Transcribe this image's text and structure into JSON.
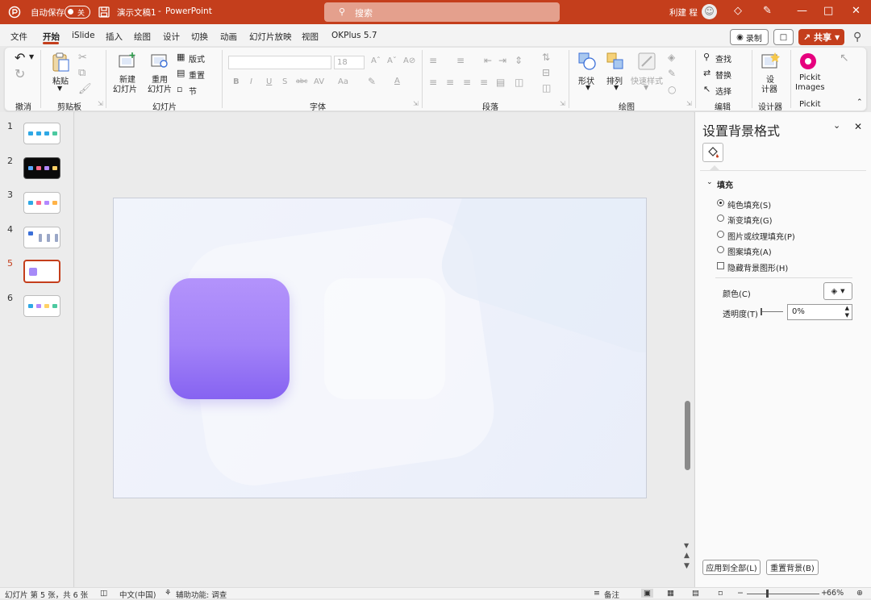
{
  "titlebar": {
    "autosave_label": "自动保存",
    "autosave_state": "关",
    "doc_title": "演示文稿1",
    "separator": "-",
    "app_name": "PowerPoint",
    "search_placeholder": "搜索",
    "user_name": "利建 程"
  },
  "menu": [
    "文件",
    "开始",
    "iSlide",
    "插入",
    "绘图",
    "设计",
    "切换",
    "动画",
    "幻灯片放映",
    "视图",
    "OKPlus 5.7"
  ],
  "menu_active": "开始",
  "top_right": {
    "record": "录制",
    "share": "共享"
  },
  "ribbon": {
    "undo_group": "撤消",
    "clipboard": {
      "paste": "粘贴",
      "label": "剪贴板"
    },
    "slides": {
      "new_1": "新建",
      "new_2": "幻灯片",
      "reuse_1": "重用",
      "reuse_2": "幻灯片",
      "layout": "版式",
      "reset": "重置",
      "section": "节",
      "label": "幻灯片"
    },
    "font": {
      "size": "18",
      "bold": "B",
      "italic": "I",
      "underline": "U",
      "shadow": "S",
      "strike": "abc",
      "spacing": "AV",
      "case": "Aa",
      "label": "字体"
    },
    "paragraph_label": "段落",
    "drawing": {
      "shape": "形状",
      "arrange": "排列",
      "quick_style": "快速样式",
      "label": "绘图"
    },
    "editing": {
      "find": "查找",
      "replace": "替换",
      "select": "选择",
      "label": "编辑"
    },
    "designer": {
      "design_1": "设",
      "design_2": "计器",
      "label": "设计器"
    },
    "pickit": {
      "name_1": "Pickit",
      "name_2": "Images",
      "label": "Pickit"
    }
  },
  "slides": [
    {
      "num": "1",
      "dots": [
        "#2ea8e5",
        "#2ea8e5",
        "#2ea8e5",
        "#4cc9a0"
      ],
      "dark": false
    },
    {
      "num": "2",
      "dots": [
        "#5aa9ff",
        "#ff6a8a",
        "#b388ff",
        "#ffd166"
      ],
      "dark": true
    },
    {
      "num": "3",
      "dots": [
        "#2ea8e5",
        "#ff6a8a",
        "#b388ff",
        "#ffb347"
      ],
      "dark": false
    },
    {
      "num": "4",
      "dots": [
        "#3a6fd8",
        "#9aa7c7",
        "#9aa7c7",
        "#9aa7c7"
      ],
      "dark": false
    },
    {
      "num": "5",
      "dots": [
        "#a68af8"
      ],
      "dark": false
    },
    {
      "num": "6",
      "dots": [
        "#2ea8e5",
        "#b388ff",
        "#ffd166",
        "#4cc9a0"
      ],
      "dark": false
    }
  ],
  "selected_slide": "5",
  "accent_color": "#c43e1c",
  "format_pane": {
    "title": "设置背景格式",
    "section": "填充",
    "options": [
      "纯色填充(S)",
      "渐变填充(G)",
      "图片或纹理填充(P)",
      "图案填充(A)"
    ],
    "selected_option": "纯色填充(S)",
    "hide_bg": "隐藏背景图形(H)",
    "color_label": "颜色(C)",
    "transparency_label": "透明度(T)",
    "transparency_value": "0%",
    "apply_all": "应用到全部(L)",
    "reset_bg": "重置背景(B)"
  },
  "status": {
    "slide_info": "幻灯片 第 5 张，共 6 张",
    "language": "中文(中国)",
    "accessibility": "辅助功能: 调查",
    "notes": "备注",
    "zoom": "66%"
  }
}
